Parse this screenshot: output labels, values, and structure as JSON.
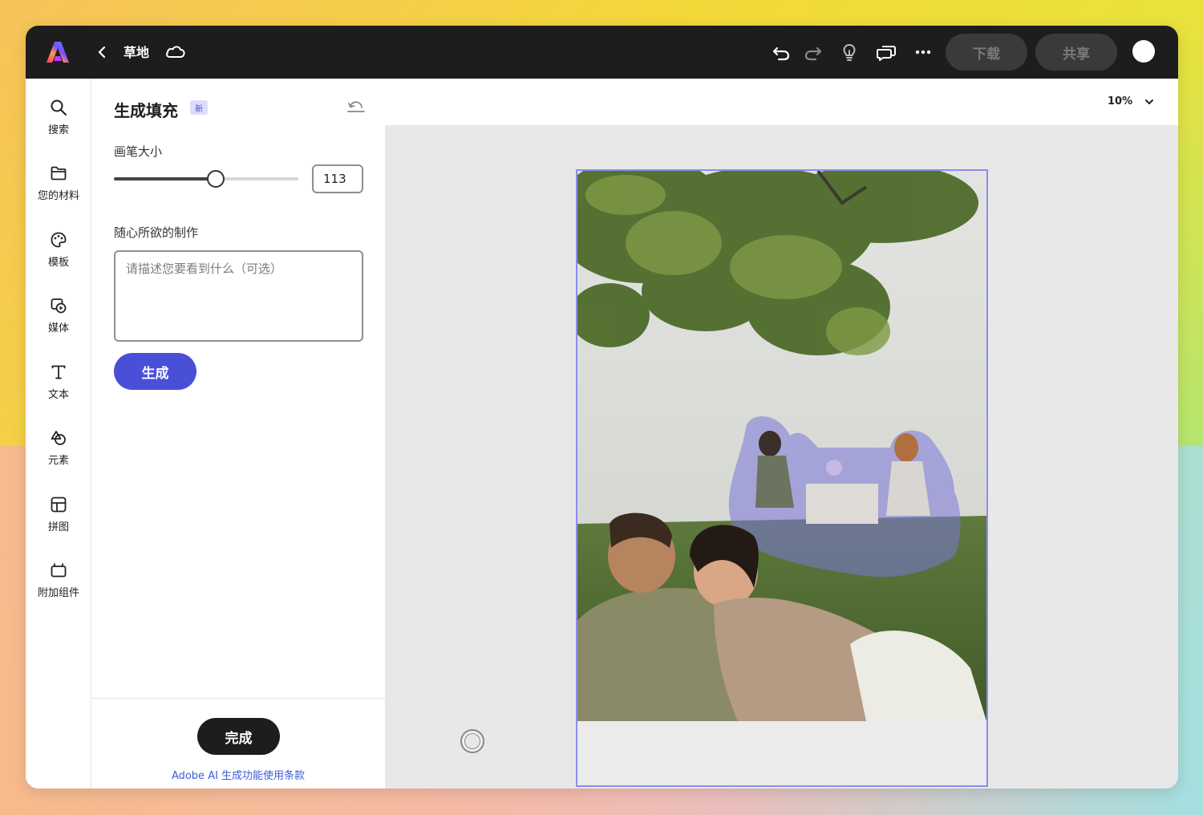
{
  "app": {
    "document_title": "草地"
  },
  "toolbar": {
    "download_label": "下载",
    "share_label": "共享",
    "icons": [
      "undo-icon",
      "redo-icon",
      "lightbulb-icon",
      "comment-icon",
      "more-icon"
    ]
  },
  "rail": {
    "items": [
      {
        "label": "搜索",
        "icon": "search-icon"
      },
      {
        "label": "您的材料",
        "icon": "folder-icon"
      },
      {
        "label": "模板",
        "icon": "template-icon"
      },
      {
        "label": "媒体",
        "icon": "media-icon"
      },
      {
        "label": "文本",
        "icon": "text-icon"
      },
      {
        "label": "元素",
        "icon": "shapes-icon"
      },
      {
        "label": "拼图",
        "icon": "grid-icon"
      },
      {
        "label": "附加组件",
        "icon": "addons-icon"
      }
    ]
  },
  "panel": {
    "title": "生成填充",
    "badge": "新",
    "brush_size_label": "画笔大小",
    "brush_size_value": "113",
    "brush_size_fraction": 0.55,
    "prompt_label": "随心所欲的制作",
    "prompt_placeholder": "请描述您要看到什么（可选）",
    "generate_label": "生成",
    "done_label": "完成",
    "terms_link": "Adobe AI 生成功能使用条款"
  },
  "canvas": {
    "zoom": "10%",
    "accent_color": "#8c8cf0"
  },
  "colors": {
    "primary": "#4a4fd8",
    "topbar": "#1d1d1d"
  }
}
